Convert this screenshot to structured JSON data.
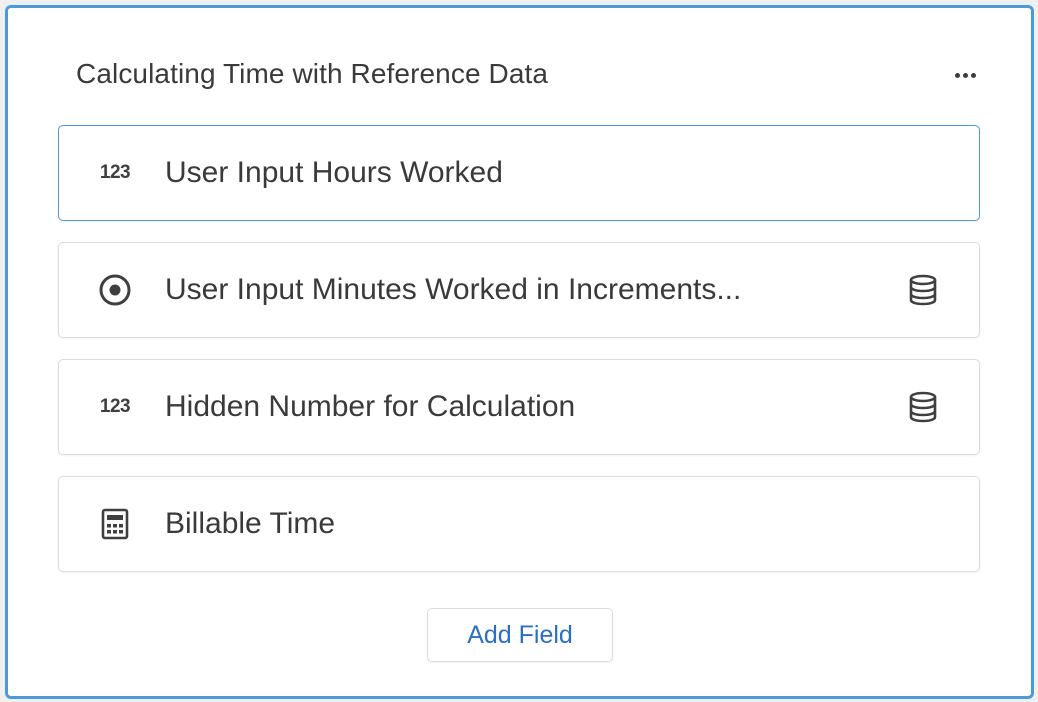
{
  "card": {
    "title": "Calculating Time with Reference Data",
    "more_icon": "more-horizontal-icon"
  },
  "fields": [
    {
      "label": "User Input Hours Worked",
      "type_icon": "number-icon",
      "type_text": "123",
      "reference_data": false,
      "selected": true
    },
    {
      "label": "User Input Minutes Worked in Increments...",
      "type_icon": "radio-icon",
      "reference_data": true,
      "selected": false
    },
    {
      "label": "Hidden Number for Calculation",
      "type_icon": "number-icon",
      "type_text": "123",
      "reference_data": true,
      "selected": false
    },
    {
      "label": "Billable Time",
      "type_icon": "calculator-icon",
      "reference_data": false,
      "selected": false
    }
  ],
  "reference_icon": "database-icon",
  "add_field": {
    "label": "Add Field"
  },
  "colors": {
    "accent_border": "#4d9ad8",
    "link_blue": "#2b6fc4",
    "text": "#3a3a3a"
  }
}
